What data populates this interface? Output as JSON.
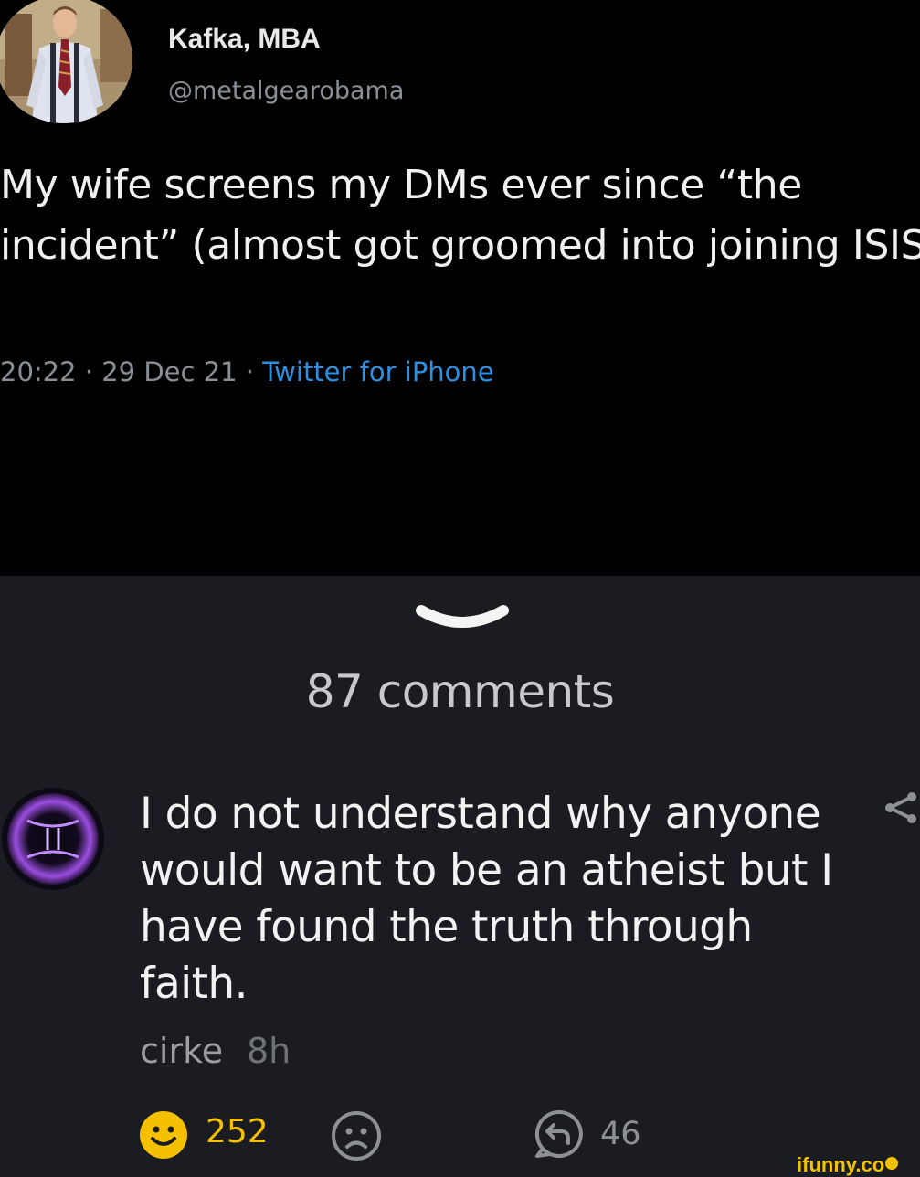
{
  "tweet": {
    "author_name": "Kafka, MBA",
    "author_handle": "@metalgearobama",
    "text": "My wife screens my DMs ever since “the incident” (almost got groomed into joining ISIS)",
    "time": "20:22",
    "date": "29 Dec 21",
    "separator": " · ",
    "source": "Twitter for iPhone"
  },
  "comments_section": {
    "count_label": "87 comments",
    "collapse_icon": "chevron-down-icon"
  },
  "comment": {
    "text": "I do not understand why anyone would want to be an atheist but I have found the truth through faith.",
    "author": "cirke",
    "time_ago": "8h",
    "smiles": "252",
    "replies": "46",
    "icons": {
      "share": "share-icon",
      "smile": "smile-icon",
      "unsmile": "frown-icon",
      "reply": "reply-icon"
    }
  },
  "watermark": "ifunny.co",
  "colors": {
    "tweet_background": "#000000",
    "comments_background": "#1b1c21",
    "link_blue": "#2d8fe0",
    "smile_yellow": "#f5c000"
  }
}
